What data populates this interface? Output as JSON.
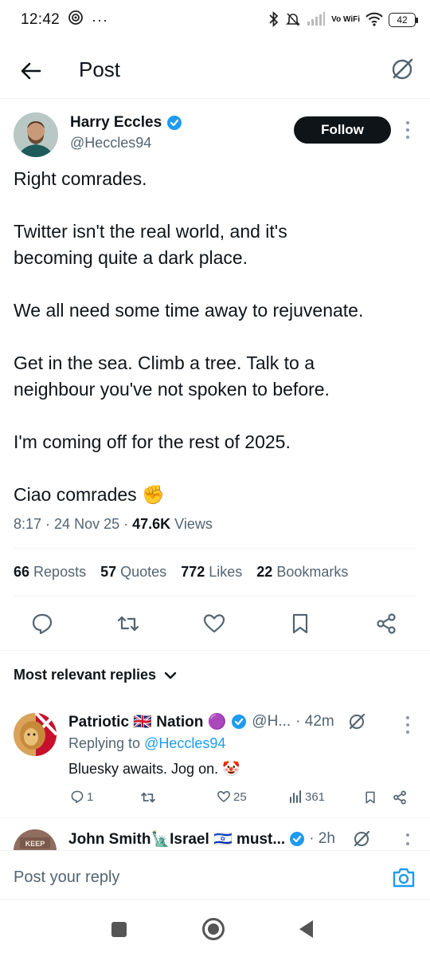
{
  "status_bar": {
    "time": "12:42",
    "network": "Vo WiFi",
    "battery": "42"
  },
  "header": {
    "title": "Post"
  },
  "post": {
    "author": {
      "name": "Harry Eccles",
      "handle": "@Heccles94"
    },
    "follow_label": "Follow",
    "paragraphs": [
      "Right comrades.",
      "Twitter isn't the real world, and it's\nbecoming quite a dark place.",
      "We all need some time away to rejuvenate.",
      "Get in the sea. Climb a tree. Talk to a\nneighbour you've not spoken to before.",
      "I'm coming off for the rest of 2025.",
      "Ciao comrades ✊"
    ],
    "time": "8:17",
    "date": "24 Nov 25",
    "views_count": "47.6K",
    "views_label": "Views",
    "stats": {
      "reposts": {
        "count": "66",
        "label": "Reposts"
      },
      "quotes": {
        "count": "57",
        "label": "Quotes"
      },
      "likes": {
        "count": "772",
        "label": "Likes"
      },
      "bookmarks": {
        "count": "22",
        "label": "Bookmarks"
      }
    }
  },
  "replies_heading": "Most relevant replies",
  "replies": [
    {
      "name": "Patriotic 🇬🇧 Nation 🟣",
      "handle": "@H...",
      "time": "· 42m",
      "replying_prefix": "Replying to",
      "replying_to": "@Heccles94",
      "text": "Bluesky awaits. Jog on. 🤡",
      "replies_count": "1",
      "likes_count": "25",
      "views_count": "361"
    },
    {
      "name": "John Smith🗽Israel 🇮🇱 must...",
      "time": "· 2h"
    }
  ],
  "composer": {
    "placeholder": "Post your reply"
  },
  "colors": {
    "accent": "#1d9bf0",
    "text": "#0f1419",
    "muted": "#536471",
    "button": "#0f1419"
  }
}
